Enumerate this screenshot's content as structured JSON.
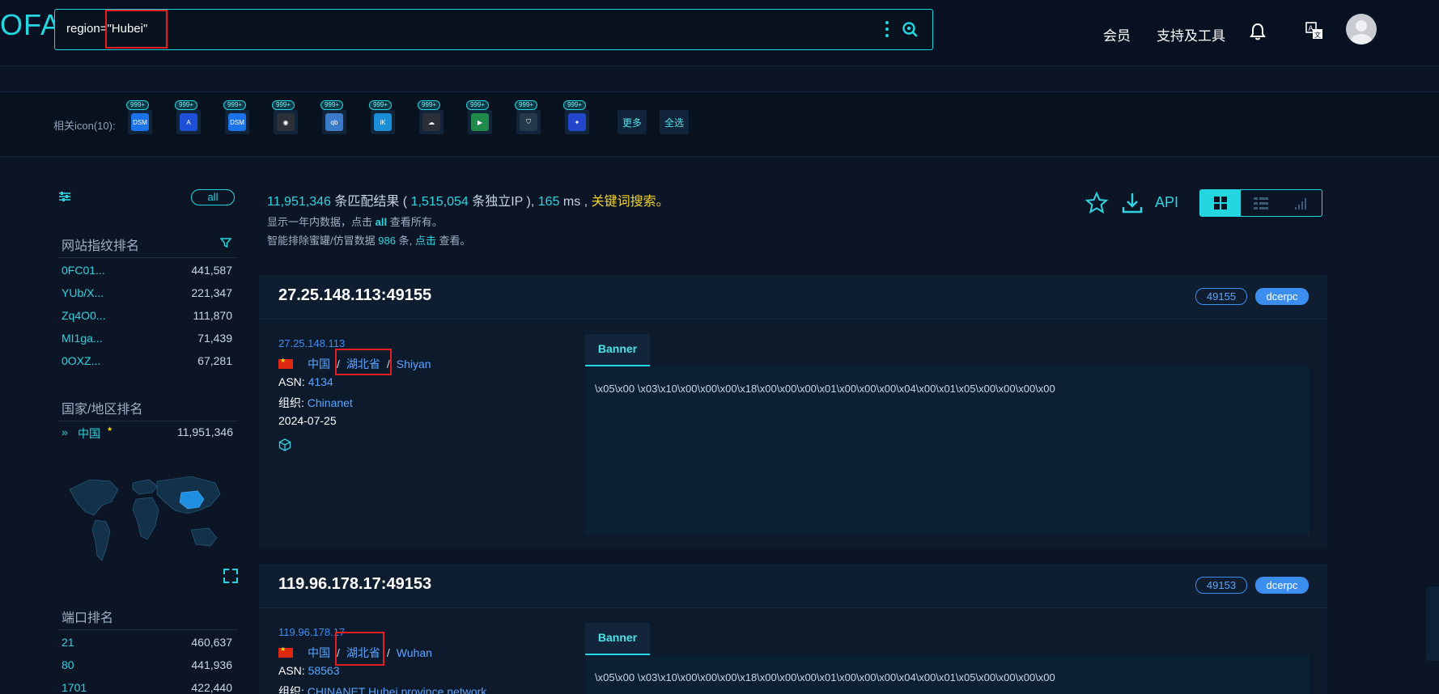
{
  "header": {
    "logo": "OFA",
    "search_query": "region=\"Hubei\"",
    "nav": {
      "vip": "会员",
      "tools": "支持及工具"
    }
  },
  "icon_band": {
    "label": "相关icon(10):",
    "items": [
      {
        "name": "dsm",
        "badge": "999+",
        "glyph": "DSM",
        "color": "#1a73e8"
      },
      {
        "name": "a-logo",
        "badge": "999+",
        "glyph": "A",
        "color": "#1e4fd8"
      },
      {
        "name": "dsm-2",
        "badge": "999+",
        "glyph": "DSM",
        "color": "#1a73e8"
      },
      {
        "name": "camera",
        "badge": "999+",
        "glyph": "◉",
        "color": "#2a2f38"
      },
      {
        "name": "qb",
        "badge": "999+",
        "glyph": "qb",
        "color": "#3b79c9"
      },
      {
        "name": "ik",
        "badge": "999+",
        "glyph": "iK",
        "color": "#1a8fd8"
      },
      {
        "name": "cloud",
        "badge": "999+",
        "glyph": "☁",
        "color": "#2a2f38"
      },
      {
        "name": "play",
        "badge": "999+",
        "glyph": "▶",
        "color": "#1f8a4c"
      },
      {
        "name": "shield",
        "badge": "999+",
        "glyph": "⛉",
        "color": "#243a4a"
      },
      {
        "name": "paw",
        "badge": "999+",
        "glyph": "✦",
        "color": "#2246c9"
      }
    ],
    "more": "更多",
    "select_all": "全选"
  },
  "sidebar": {
    "all": "all",
    "fingerprint_title": "网站指纹排名",
    "fingerprints": [
      {
        "name": "0FC01...",
        "count": "441,587"
      },
      {
        "name": "YUb/X...",
        "count": "221,347"
      },
      {
        "name": "Zq4O0...",
        "count": "111,870"
      },
      {
        "name": "MI1ga...",
        "count": "71,439"
      },
      {
        "name": "0OXZ...",
        "count": "67,281"
      }
    ],
    "country_title": "国家/地区排名",
    "countries": [
      {
        "name": "中国",
        "count": "11,951,346"
      }
    ],
    "port_title": "端口排名",
    "ports": [
      {
        "name": "21",
        "count": "460,637"
      },
      {
        "name": "80",
        "count": "441,936"
      },
      {
        "name": "1701",
        "count": "422,440"
      }
    ]
  },
  "summary": {
    "total": "11,951,346",
    "total_label": "条匹配结果 (",
    "unique_ip": "1,515,054",
    "unique_label": "条独立IP ),",
    "ms": "165",
    "ms_label": "ms ,",
    "keyword": "关键词搜索。",
    "line2_a": "显示一年内数据，点击",
    "line2_all": "all",
    "line2_b": "查看所有。",
    "line3_a": "智能排除蜜罐/仿冒数据",
    "line3_num": "986",
    "line3_b": "条,",
    "line3_link": "点击",
    "line3_c": "查看。",
    "api": "API"
  },
  "results": [
    {
      "title": "27.25.148.113:49155",
      "port": "49155",
      "protocol": "dcerpc",
      "ip": "27.25.148.113",
      "country": "中国",
      "province": "湖北省",
      "city": "Shiyan",
      "asn_label": "ASN:",
      "asn": "4134",
      "org_label": "组织:",
      "org": "Chinanet",
      "date": "2024-07-25",
      "banner_tab": "Banner",
      "banner": "\\x05\\x00 \\x03\\x10\\x00\\x00\\x00\\x18\\x00\\x00\\x00\\x01\\x00\\x00\\x00\\x04\\x00\\x01\\x05\\x00\\x00\\x00\\x00"
    },
    {
      "title": "119.96.178.17:49153",
      "port": "49153",
      "protocol": "dcerpc",
      "ip": "119.96.178.17",
      "country": "中国",
      "province": "湖北省",
      "city": "Wuhan",
      "asn_label": "ASN:",
      "asn": "58563",
      "org_label": "组织:",
      "org": "CHINANET Hubei province network",
      "banner_tab": "Banner",
      "banner": "\\x05\\x00 \\x03\\x10\\x00\\x00\\x00\\x18\\x00\\x00\\x00\\x01\\x00\\x00\\x00\\x04\\x00\\x01\\x05\\x00\\x00\\x00\\x00"
    }
  ]
}
